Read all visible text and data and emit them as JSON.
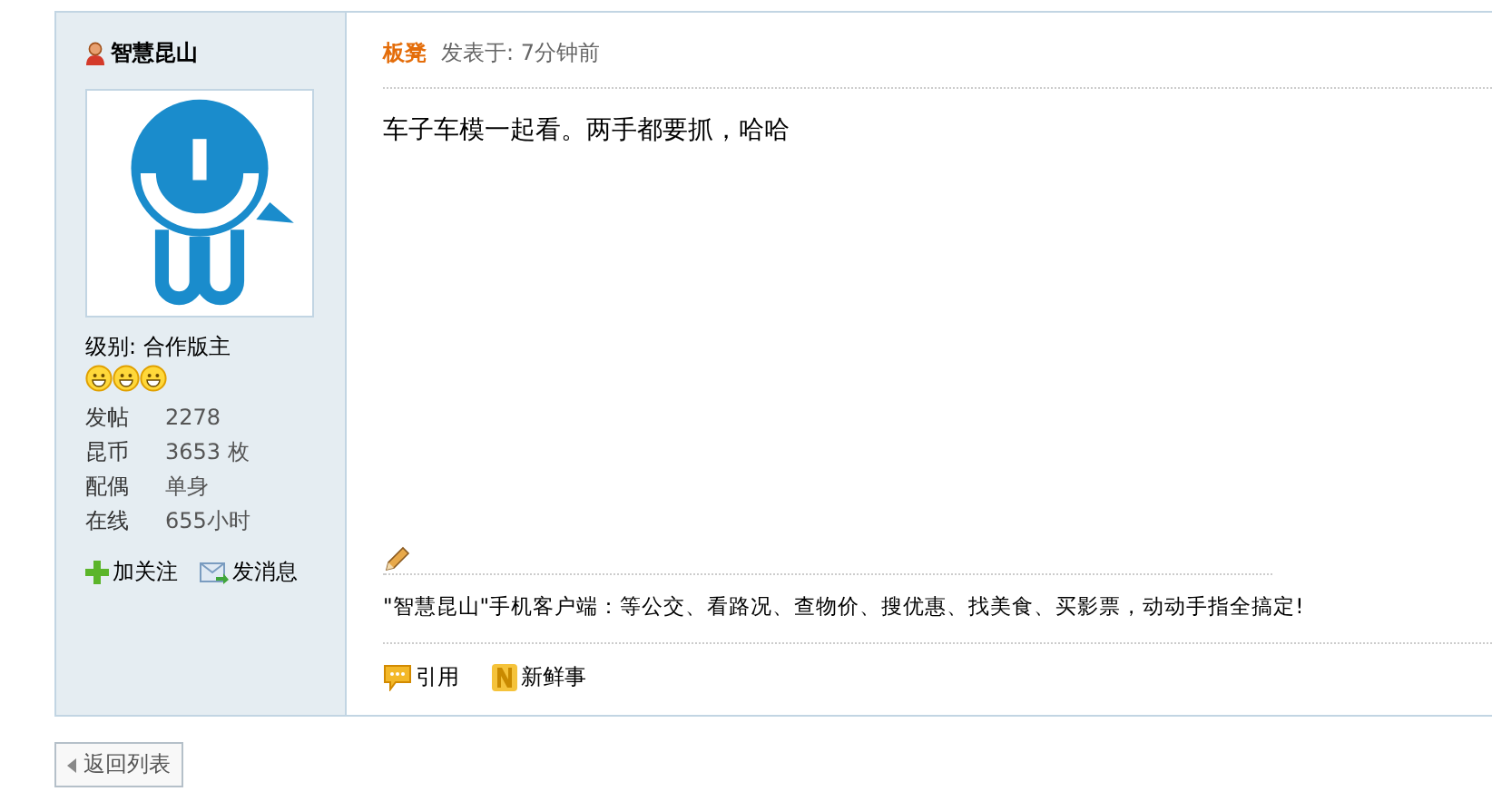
{
  "author": {
    "name": "智慧昆山",
    "level_label": "级别: 合作版主",
    "rank_icons": [
      {
        "kind": "smiley"
      },
      {
        "kind": "smiley"
      },
      {
        "kind": "smiley"
      }
    ],
    "stats": [
      {
        "label": "发帖",
        "value": "2278"
      },
      {
        "label": "昆币",
        "value": "3653 枚"
      },
      {
        "label": "配偶",
        "value": "单身"
      },
      {
        "label": "在线",
        "value": "655小时"
      }
    ],
    "actions": [
      {
        "kind": "follow",
        "label": "加关注"
      },
      {
        "kind": "message",
        "label": "发消息"
      }
    ]
  },
  "post": {
    "floor": "板凳",
    "posted": "发表于: 7分钟前",
    "body": "车子车模一起看。两手都要抓，哈哈",
    "signature": "\"智慧昆山\"手机客户端：等公交、看路况、查物价、搜优惠、找美食、买影票，动动手指全搞定!",
    "actions": [
      {
        "kind": "quote",
        "label": "引用"
      },
      {
        "kind": "news",
        "label": "新鲜事"
      }
    ]
  },
  "back_button": {
    "label": "返回列表"
  }
}
